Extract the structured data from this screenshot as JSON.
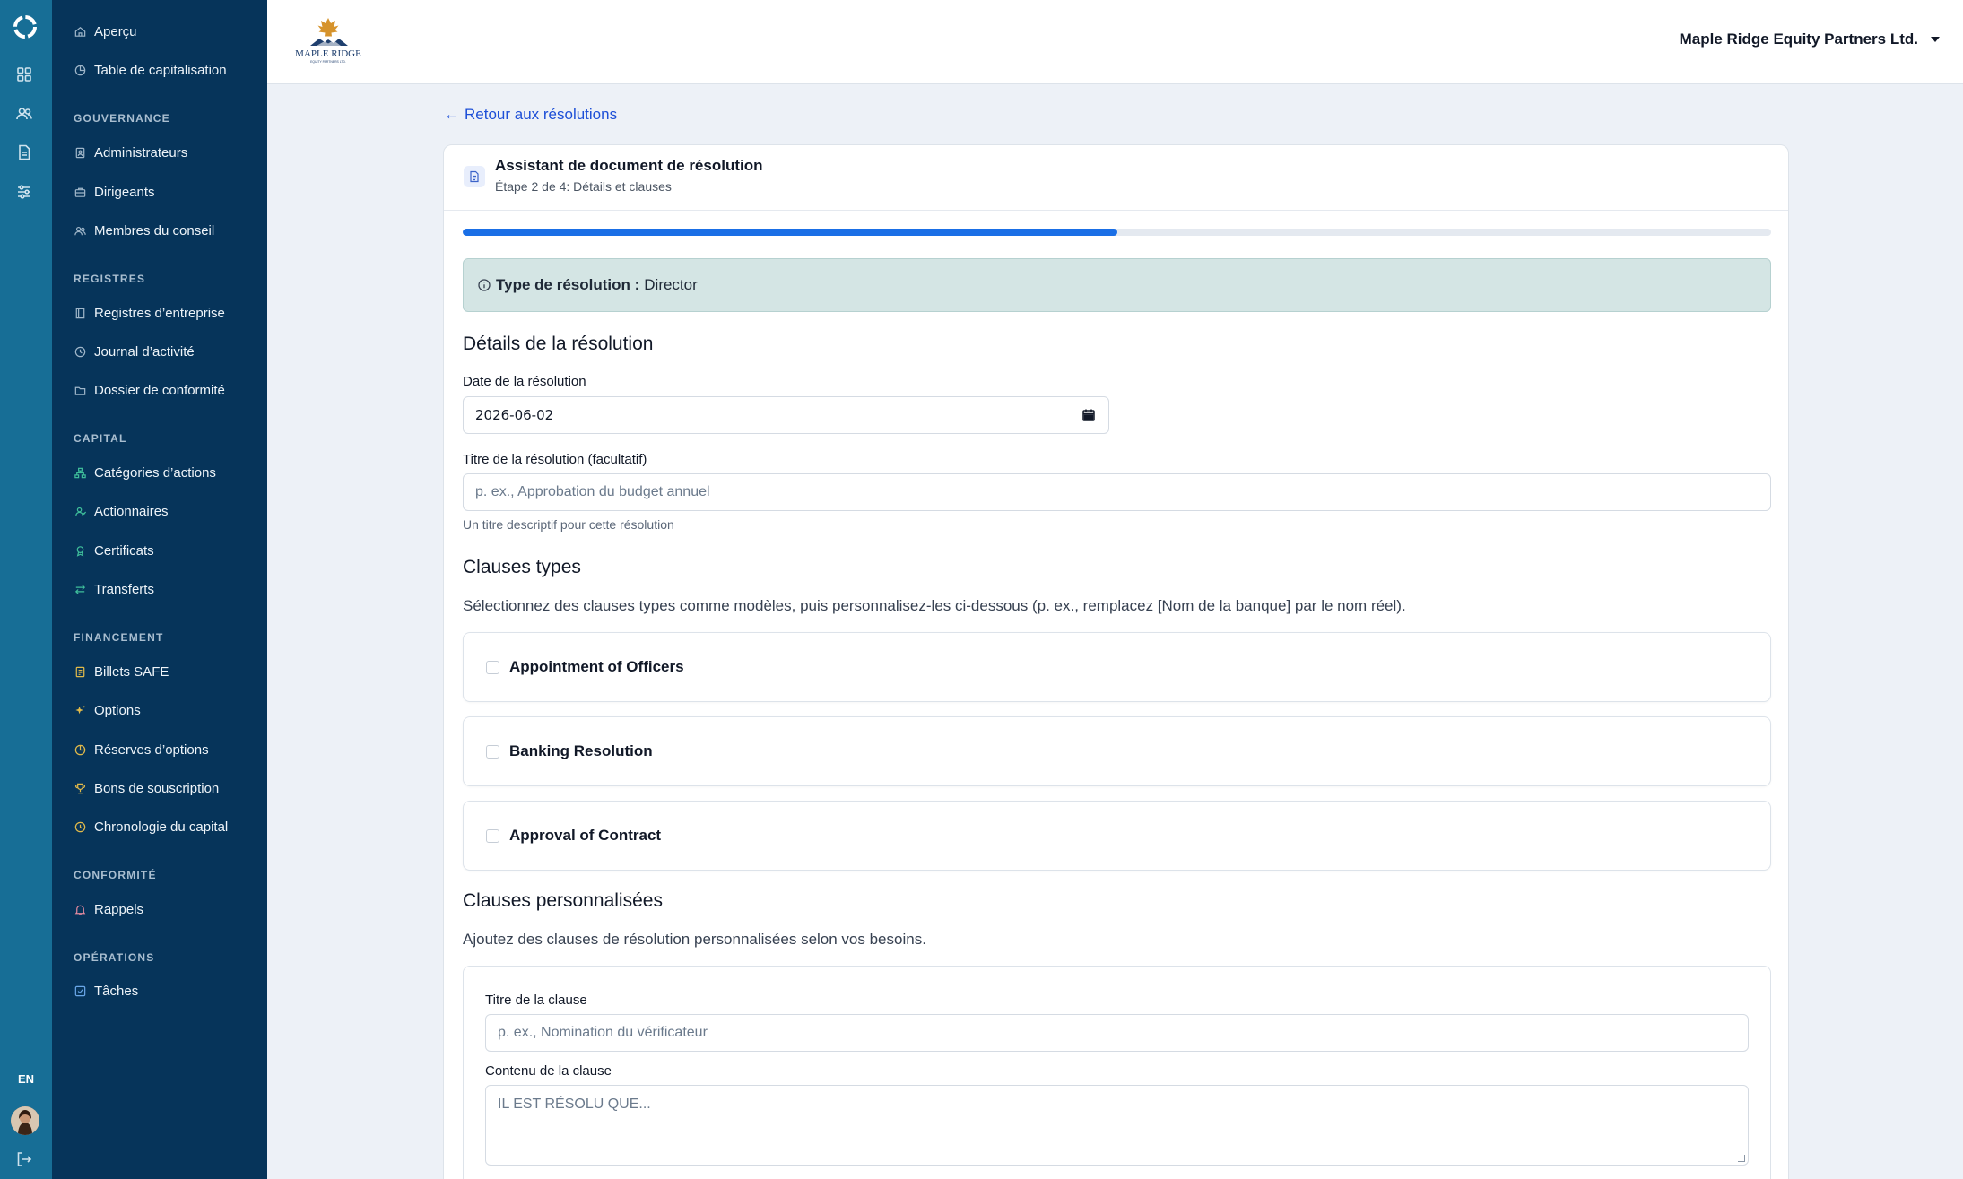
{
  "sidebar": {
    "items": [
      {
        "label": "Aperçu",
        "icon": "home-icon"
      },
      {
        "label": "Table de capitalisation",
        "icon": "pie-chart-icon"
      },
      {
        "label": "Administrateurs",
        "icon": "badge-icon"
      },
      {
        "label": "Dirigeants",
        "icon": "briefcase-icon"
      },
      {
        "label": "Membres du conseil",
        "icon": "users-icon"
      },
      {
        "label": "Registres d’entreprise",
        "icon": "book-icon"
      },
      {
        "label": "Journal d’activité",
        "icon": "clock-icon"
      },
      {
        "label": "Dossier de conformité",
        "icon": "folder-icon"
      },
      {
        "label": "Catégories d’actions",
        "icon": "network-icon"
      },
      {
        "label": "Actionnaires",
        "icon": "user-group-icon"
      },
      {
        "label": "Certificats",
        "icon": "award-icon"
      },
      {
        "label": "Transferts",
        "icon": "transfer-icon"
      },
      {
        "label": "Billets SAFE",
        "icon": "note-icon"
      },
      {
        "label": "Options",
        "icon": "sparkle-icon"
      },
      {
        "label": "Réserves d’options",
        "icon": "pie-chart-icon"
      },
      {
        "label": "Bons de souscription",
        "icon": "trophy-icon"
      },
      {
        "label": "Chronologie du capital",
        "icon": "clock-icon"
      },
      {
        "label": "Rappels",
        "icon": "bell-icon"
      },
      {
        "label": "Tâches",
        "icon": "check-square-icon"
      }
    ],
    "sections": {
      "gouvernance": "GOUVERNANCE",
      "registres": "REGISTRES",
      "capital": "CAPITAL",
      "financement": "FINANCEMENT",
      "conformite": "CONFORMITÉ",
      "operations": "OPÉRATIONS"
    }
  },
  "rail": {
    "lang": "EN"
  },
  "header": {
    "brand_name": "MAPLE RIDGE",
    "brand_sub": "EQUITY PARTNERS LTD.",
    "org_name": "Maple Ridge Equity Partners Ltd."
  },
  "main": {
    "back_link": "Retour aux résolutions",
    "wizard": {
      "title": "Assistant de document de résolution",
      "subtitle": "Étape 2 de 4: Détails et clauses",
      "progress": 0.5
    },
    "alert": {
      "label": "Type de résolution :",
      "value": "Director"
    },
    "details": {
      "heading": "Détails de la résolution",
      "date_label": "Date de la résolution",
      "date_value": "2026-06-02",
      "title_label": "Titre de la résolution (facultatif)",
      "title_placeholder": "p. ex., Approbation du budget annuel",
      "title_hint": "Un titre descriptif pour cette résolution"
    },
    "standard_clauses": {
      "heading": "Clauses types",
      "description": "Sélectionnez des clauses types comme modèles, puis personnalisez-les ci-dessous (p. ex., remplacez [Nom de la banque] par le nom réel).",
      "items": [
        {
          "label": "Appointment of Officers",
          "checked": false
        },
        {
          "label": "Banking Resolution",
          "checked": false
        },
        {
          "label": "Approval of Contract",
          "checked": false
        }
      ]
    },
    "custom_clauses": {
      "heading": "Clauses personnalisées",
      "description": "Ajoutez des clauses de résolution personnalisées selon vos besoins.",
      "clause_title_label": "Titre de la clause",
      "clause_title_placeholder": "p. ex., Nomination du vérificateur",
      "clause_content_label": "Contenu de la clause",
      "clause_content_placeholder": "IL EST RÉSOLU QUE..."
    }
  },
  "colors": {
    "rail": "#176e96",
    "sidebar": "#06345a",
    "accent": "#1a6fe6",
    "alert_bg": "#d4e5e4"
  }
}
